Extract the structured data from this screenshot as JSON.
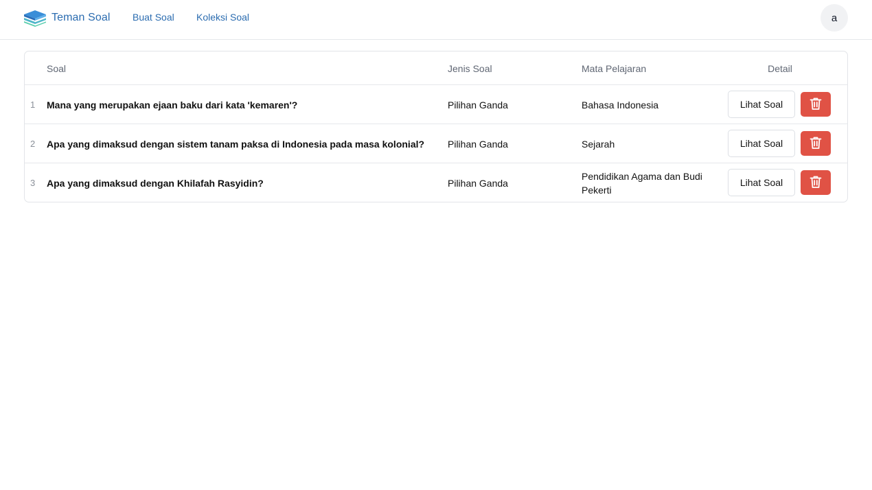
{
  "app": {
    "brand_name": "Teman Soal",
    "brand_icon": "stacked-books-logo",
    "accent_color": "#2b6cb0"
  },
  "nav": {
    "items": [
      {
        "label": "Buat Soal"
      },
      {
        "label": "Koleksi Soal"
      }
    ],
    "avatar_initial": "a"
  },
  "table": {
    "headers": {
      "soal": "Soal",
      "jenis": "Jenis Soal",
      "mapel": "Mata Pelajaran",
      "detail": "Detail"
    },
    "rows": [
      {
        "no": "1",
        "soal": "Mana yang merupakan ejaan baku dari kata 'kemaren'?",
        "jenis": "Pilihan Ganda",
        "mapel": "Bahasa Indonesia",
        "view_label": "Lihat Soal"
      },
      {
        "no": "2",
        "soal": "Apa yang dimaksud dengan sistem tanam paksa di Indonesia pada masa kolonial?",
        "jenis": "Pilihan Ganda",
        "mapel": "Sejarah",
        "view_label": "Lihat Soal"
      },
      {
        "no": "3",
        "soal": "Apa yang dimaksud dengan Khilafah Rasyidin?",
        "jenis": "Pilihan Ganda",
        "mapel": "Pendidikan Agama dan Budi Pekerti",
        "view_label": "Lihat Soal"
      }
    ],
    "delete_icon": "trash-icon",
    "delete_color": "#e05245"
  }
}
